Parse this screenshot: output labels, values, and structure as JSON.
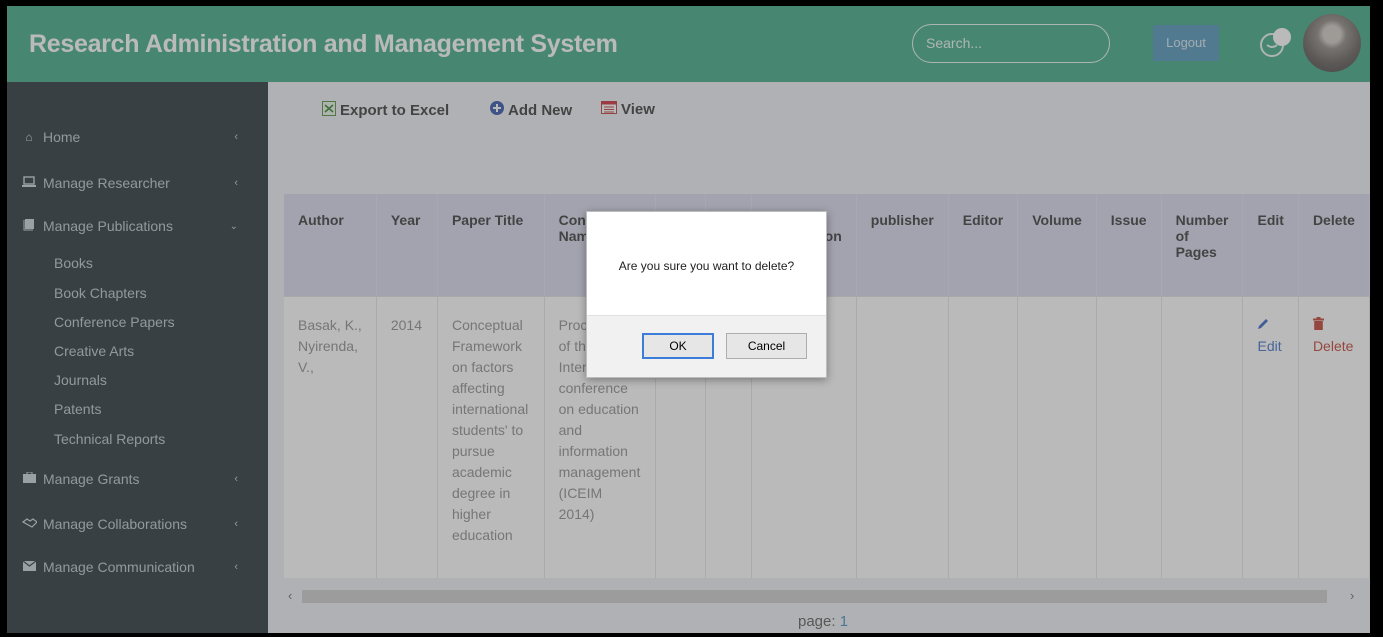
{
  "header": {
    "title": "Research Administration and Management System",
    "search_placeholder": "Search...",
    "logout_label": "Logout",
    "chat_icon": "chat-bubble-icon",
    "avatar_icon": "user-avatar"
  },
  "sidebar": {
    "items": [
      {
        "label": "Home",
        "icon": "home-icon"
      },
      {
        "label": "Manage Researcher",
        "icon": "laptop-icon"
      },
      {
        "label": "Manage Publications",
        "icon": "book-icon"
      },
      {
        "label": "Manage Grants",
        "icon": "briefcase-icon"
      },
      {
        "label": "Manage Collaborations",
        "icon": "handshake-icon"
      },
      {
        "label": "Manage Communication",
        "icon": "envelope-icon"
      }
    ],
    "publications_sub": [
      "Books",
      "Book Chapters",
      "Conference Papers",
      "Creative Arts",
      "Journals",
      "Patents",
      "Technical Reports"
    ]
  },
  "toolbar": {
    "export_label": "Export to Excel",
    "add_label": "Add New",
    "view_label": "View"
  },
  "table": {
    "headers": [
      "Author",
      "Year",
      "Paper Title",
      "Conference Name",
      "",
      "",
      "Place of Publication",
      "publisher",
      "Editor",
      "Volume",
      "Issue",
      "Number of Pages",
      "Edit",
      "Delete"
    ],
    "row": {
      "author": "Basak, K., Nyirenda, V.,",
      "year": "2014",
      "paper_title": "Conceptual Framework on factors affecting international students' to pursue academic degree in higher education",
      "conference_name": "Proceedings of the International conference on education and information management (ICEIM 2014)",
      "edit_label": "Edit",
      "delete_label": "Delete"
    }
  },
  "pager": {
    "label": "page:",
    "current": "1"
  },
  "dialog": {
    "message": "Are you sure you want to delete?",
    "ok_label": "OK",
    "cancel_label": "Cancel"
  },
  "colors": {
    "header": "#3aa783",
    "sidebar": "#222d32",
    "table_header": "#d7d7ec",
    "logout": "#4a8fb6"
  }
}
